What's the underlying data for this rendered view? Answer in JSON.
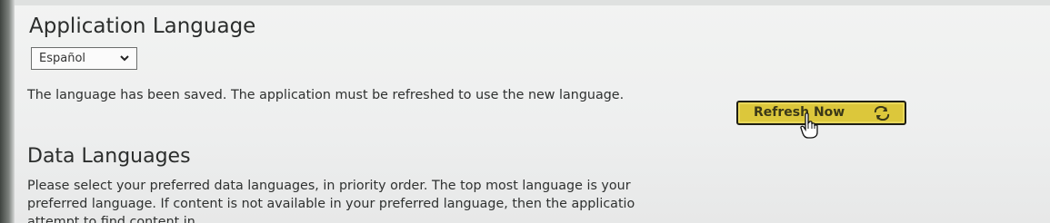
{
  "application_language": {
    "title": "Application Language",
    "selected_language": "Español",
    "saved_message": "The language has been saved. The application must be refreshed to use the new language.",
    "refresh_button_label": "Refresh Now",
    "refresh_icon": "refresh-icon"
  },
  "data_languages": {
    "title": "Data Languages",
    "description_lines": [
      "Please select your preferred data languages, in priority order. The top most language is your",
      "preferred language. If content is not available in your preferred language, then the applicatio",
      "attempt to find content in"
    ]
  },
  "colors": {
    "refresh_button_bg": "#dcc73b",
    "refresh_button_border": "#1f1f14"
  }
}
